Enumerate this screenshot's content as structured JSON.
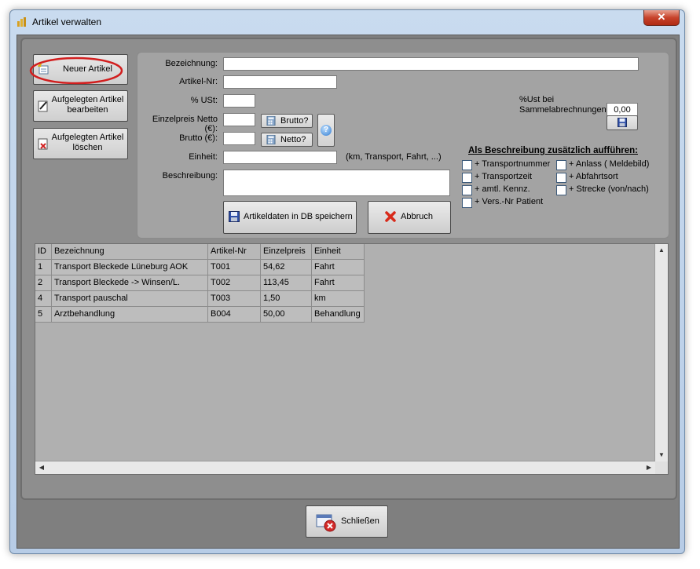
{
  "window": {
    "title": "Artikel verwalten",
    "close_glyph": "✕"
  },
  "left_buttons": [
    {
      "label": "Neuer Artikel",
      "icon": "new-item-icon"
    },
    {
      "line1": "Aufgelegten Artikel",
      "line2": "bearbeiten",
      "icon": "edit-icon"
    },
    {
      "line1": "Aufgelegten Artikel",
      "line2": "löschen",
      "icon": "delete-doc-icon"
    }
  ],
  "form": {
    "bezeichnung_label": "Bezeichnung:",
    "bezeichnung_value": "",
    "artikelnr_label": "Artikel-Nr:",
    "artikelnr_value": "",
    "ust_label": "% USt:",
    "ust_value": "",
    "netto_label": "Einzelpreis Netto (€):",
    "netto_value": "",
    "brutto_btn": "Brutto?",
    "brutto_label": "Brutto (€):",
    "brutto_value": "",
    "netto_btn": "Netto?",
    "help_glyph": "?",
    "einheit_label": "Einheit:",
    "einheit_value": "",
    "einheit_hint": "(km, Transport, Fahrt, ...)",
    "beschreibung_label": "Beschreibung:",
    "beschreibung_value": "",
    "save_btn": "Artikeldaten in DB speichern",
    "cancel_btn": "Abbruch",
    "sammel_label_line1": "%Ust bei",
    "sammel_label_line2": "Sammelabrechnungen",
    "sammel_value": "0,00",
    "extra_heading": "Als Beschreibung zusätzlich aufführen:",
    "checkboxes_left": [
      "+ Transportnummer",
      "+ Transportzeit",
      "+ amtl. Kennz.",
      "+ Vers.-Nr Patient"
    ],
    "checkboxes_right": [
      "+ Anlass ( Meldebild)",
      "+ Abfahrtsort",
      "+ Strecke (von/nach)"
    ]
  },
  "grid": {
    "columns": [
      "ID",
      "Bezeichnung",
      "Artikel-Nr",
      "Einzelpreis",
      "Einheit"
    ],
    "rows": [
      [
        "1",
        "Transport Bleckede Lüneburg AOK",
        "T001",
        "54,62",
        "Fahrt"
      ],
      [
        "2",
        "Transport Bleckede -> Winsen/L.",
        "T002",
        "113,45",
        "Fahrt"
      ],
      [
        "4",
        "Transport pauschal",
        "T003",
        "1,50",
        "km"
      ],
      [
        "5",
        "Arztbehandlung",
        "B004",
        "50,00",
        "Behandlung"
      ]
    ]
  },
  "footer": {
    "close_btn": "Schließen"
  }
}
